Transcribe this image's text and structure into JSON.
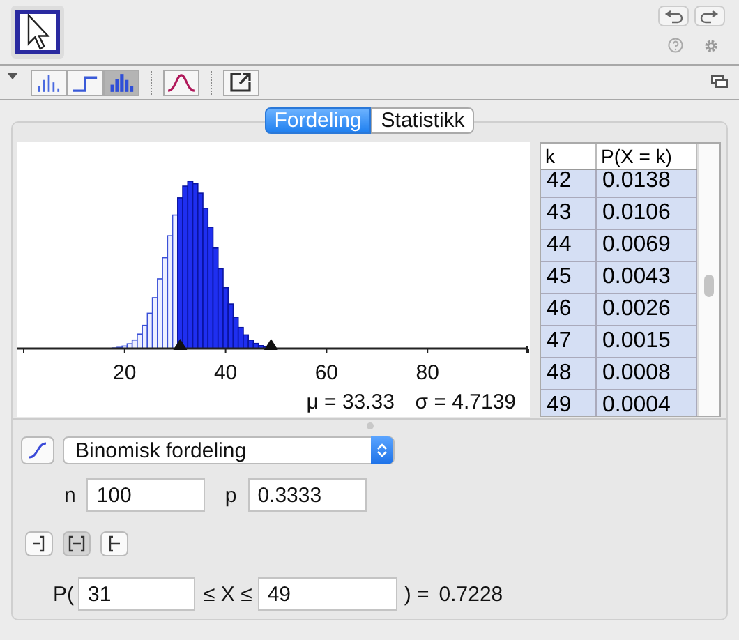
{
  "toolbar": {
    "tools": [
      {
        "kind": "pointer",
        "selected": true
      }
    ],
    "view_buttons": [
      {
        "kind": "bars",
        "selected": false
      },
      {
        "kind": "step",
        "selected": false
      },
      {
        "kind": "histogram",
        "selected": true
      }
    ],
    "overlay_buttons": [
      {
        "kind": "normal-curve",
        "selected": false
      }
    ]
  },
  "tabs": [
    {
      "label": "Fordeling",
      "selected": true
    },
    {
      "label": "Statistikk",
      "selected": false
    }
  ],
  "plot": {
    "x_ticks": [
      "20",
      "40",
      "60",
      "80"
    ],
    "mean": "μ = 33.33",
    "sd": "σ = 4.7139"
  },
  "table": {
    "columns": [
      "k",
      "P(X = k)"
    ],
    "rows": [
      {
        "k": "42",
        "p": "0.0138",
        "selected": true
      },
      {
        "k": "43",
        "p": "0.0106",
        "selected": true
      },
      {
        "k": "44",
        "p": "0.0069",
        "selected": true
      },
      {
        "k": "45",
        "p": "0.0043",
        "selected": true
      },
      {
        "k": "46",
        "p": "0.0026",
        "selected": true
      },
      {
        "k": "47",
        "p": "0.0015",
        "selected": true
      },
      {
        "k": "48",
        "p": "0.0008",
        "selected": true
      },
      {
        "k": "49",
        "p": "0.0004",
        "selected": true
      }
    ]
  },
  "distribution": {
    "name": "Binomisk fordeling"
  },
  "parameters": [
    {
      "label": "n",
      "value": "100"
    },
    {
      "label": "p",
      "value": "0.3333"
    }
  ],
  "interval_buttons": [
    {
      "kind": "left",
      "selected": false
    },
    {
      "kind": "two-sided",
      "selected": true
    },
    {
      "kind": "right",
      "selected": false
    }
  ],
  "probability": {
    "prefix": "P(",
    "lower": "31",
    "relation": "≤ X ≤",
    "upper": "49",
    "suffix": ") =",
    "result": "0.7228"
  }
}
